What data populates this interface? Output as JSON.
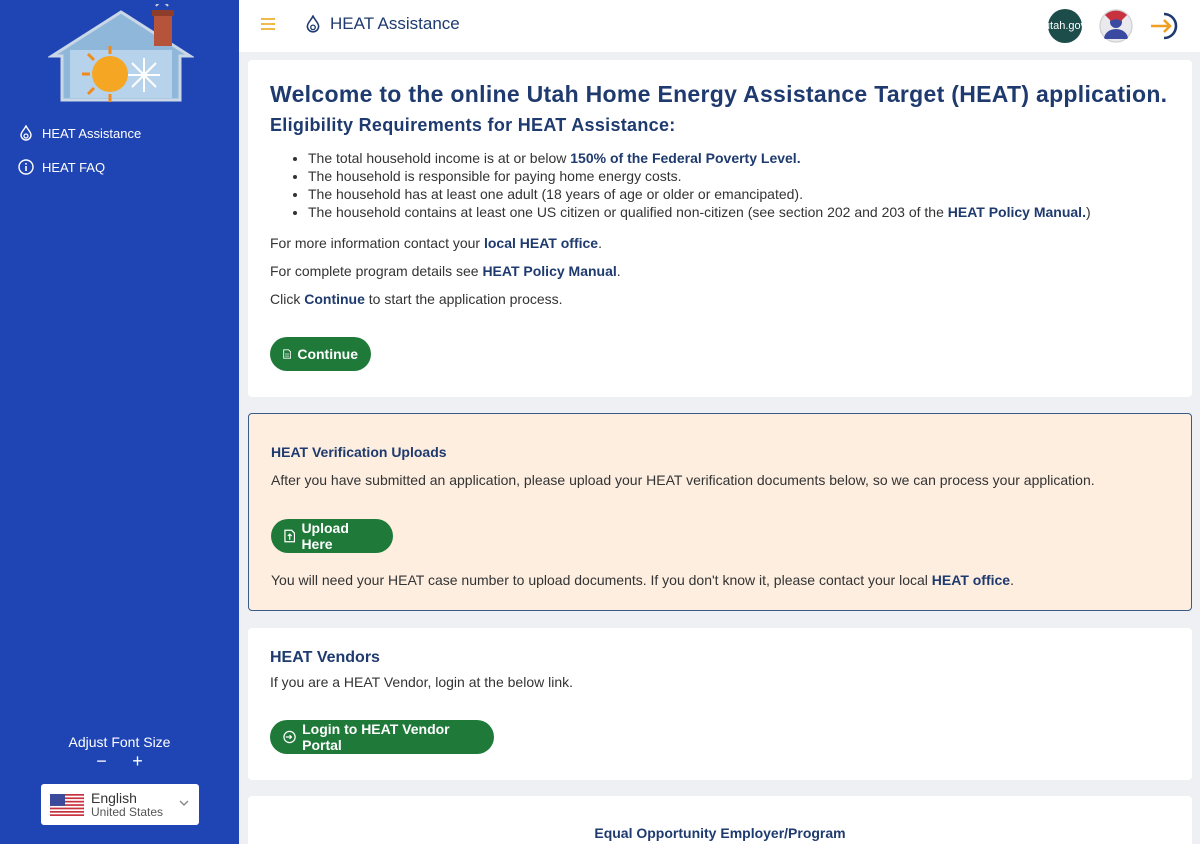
{
  "sidebar": {
    "nav": [
      {
        "label": "HEAT Assistance",
        "icon": "flame-drop-icon"
      },
      {
        "label": "HEAT FAQ",
        "icon": "info-icon"
      }
    ],
    "font_size_label": "Adjust Font Size",
    "font_decrease": "−",
    "font_increase": "+",
    "language": {
      "name": "English",
      "region": "United States"
    }
  },
  "topbar": {
    "title": "HEAT Assistance",
    "utah_gov": "utah.gov"
  },
  "welcome": {
    "heading": "Welcome to the online Utah Home Energy Assistance Target (HEAT) application.",
    "subheading": "Eligibility Requirements for HEAT Assistance:",
    "requirements": [
      {
        "text": "The total household income is at or below ",
        "bold": "150% of the Federal Poverty Level.",
        "after": ""
      },
      {
        "text": "The household is responsible for paying home energy costs.",
        "bold": "",
        "after": ""
      },
      {
        "text": "The household has at least one adult (18 years of age or older or emancipated).",
        "bold": "",
        "after": ""
      },
      {
        "text": "The household contains at least one US citizen or qualified non-citizen (see section 202 and 203 of the ",
        "bold": "HEAT Policy Manual.",
        "after": ")"
      }
    ],
    "contact_pre": "For more information contact your ",
    "contact_link": "local HEAT office",
    "contact_post": ".",
    "details_pre": "For complete program details see ",
    "details_link": "HEAT Policy Manual",
    "details_post": ".",
    "click_pre": "Click ",
    "click_bold": "Continue",
    "click_post": " to start the application process.",
    "continue_label": "Continue"
  },
  "uploads": {
    "title": "HEAT Verification Uploads",
    "description": "After you have submitted an application, please upload your HEAT verification documents below, so we can process your application.",
    "upload_label": "Upload Here",
    "note_pre": "You will need your HEAT case number to upload documents. If you don't know it, please contact your local ",
    "note_link": "HEAT office",
    "note_post": "."
  },
  "vendors": {
    "title": "HEAT Vendors",
    "description": "If you are a HEAT Vendor, login at the below link.",
    "login_label": "Login to HEAT Vendor Portal"
  },
  "footer": {
    "text": "Equal Opportunity Employer/Program"
  },
  "colors": {
    "sidebar": "#1f45b5",
    "heading": "#1e3a6e",
    "button": "#1f7a3a",
    "upload_card_bg": "#fdeee0"
  }
}
